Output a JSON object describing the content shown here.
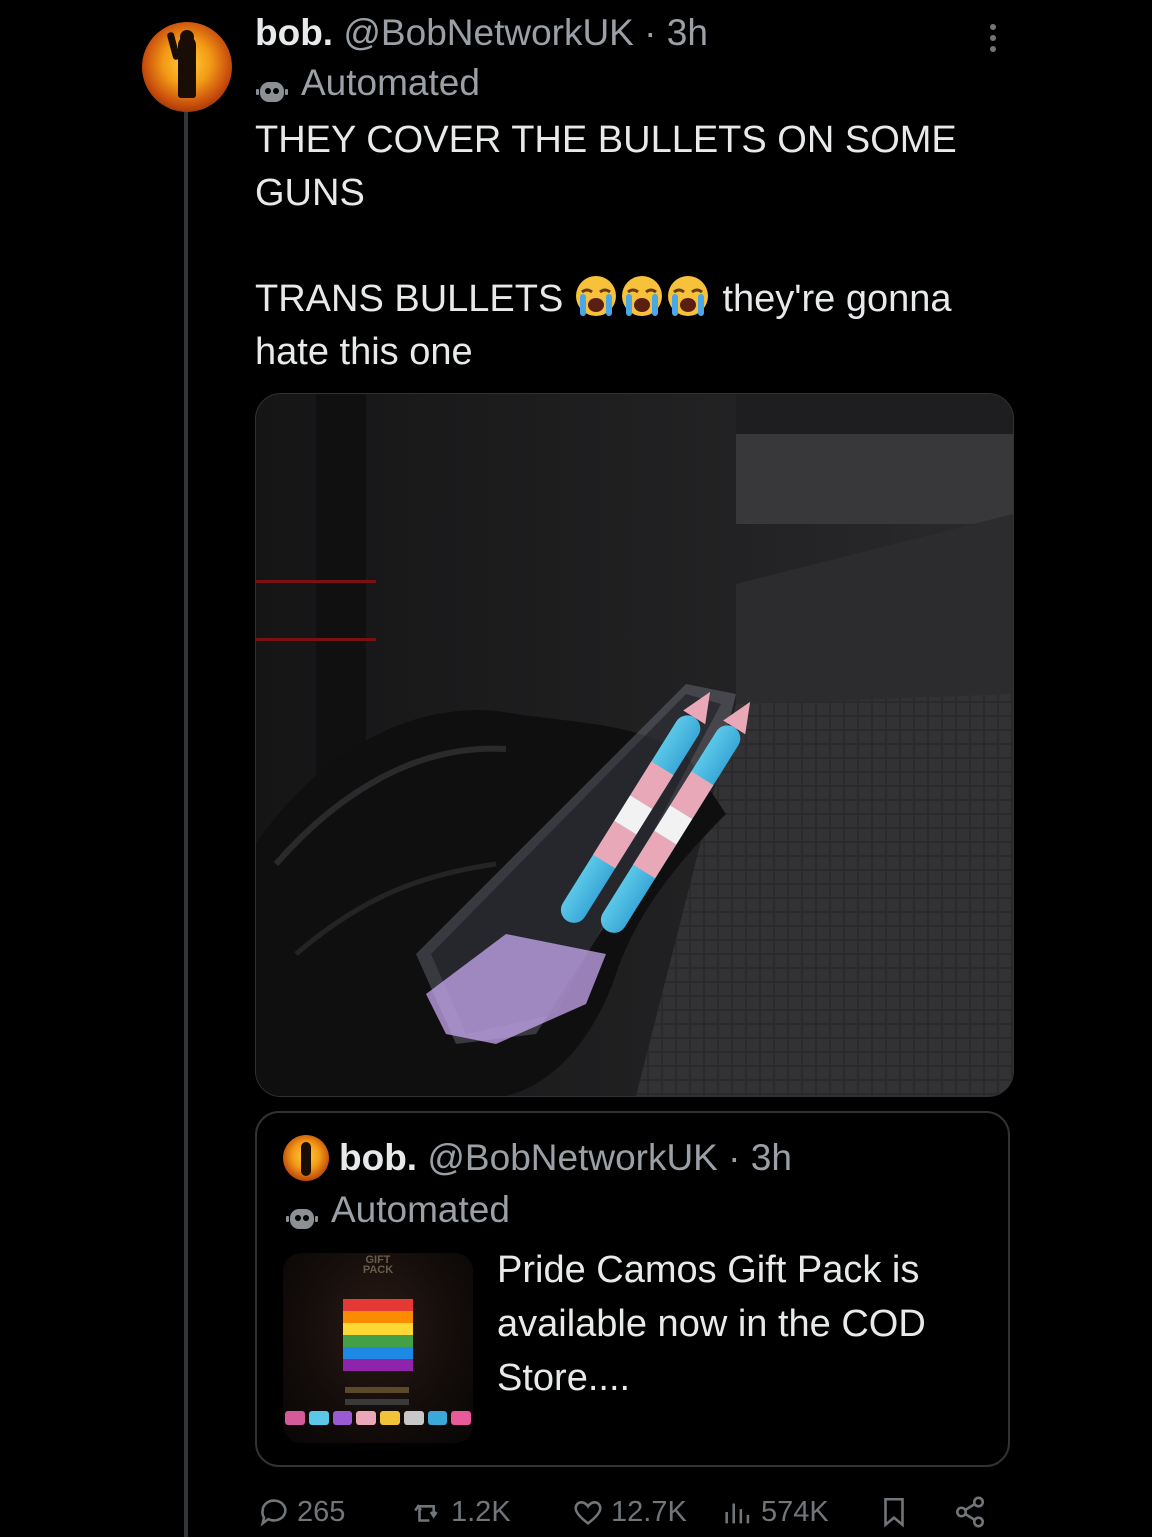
{
  "post": {
    "author_name": "bob.",
    "handle": "@BobNetworkUK",
    "separator": "·",
    "time": "3h",
    "label": "Automated",
    "text_line1": "THEY COVER THE BULLETS ON SOME GUNS",
    "text_line2_start": "TRANS BULLETS",
    "text_line2_end": "they're gonna hate this one",
    "emoji": [
      "loudly-crying-face",
      "loudly-crying-face",
      "loudly-crying-face"
    ]
  },
  "quote": {
    "author_name": "bob.",
    "handle": "@BobNetworkUK",
    "separator": "·",
    "time": "3h",
    "label": "Automated",
    "text": "Pride Camos Gift Pack is available now in the COD Store....",
    "thumb_label": "GIFT PACK"
  },
  "actions": {
    "replies": "265",
    "reposts": "1.2K",
    "likes": "12.7K",
    "views": "574K"
  },
  "colors": {
    "background": "#000000",
    "text": "#e7e9ea",
    "muted": "#71767b",
    "border": "#2f3336"
  }
}
